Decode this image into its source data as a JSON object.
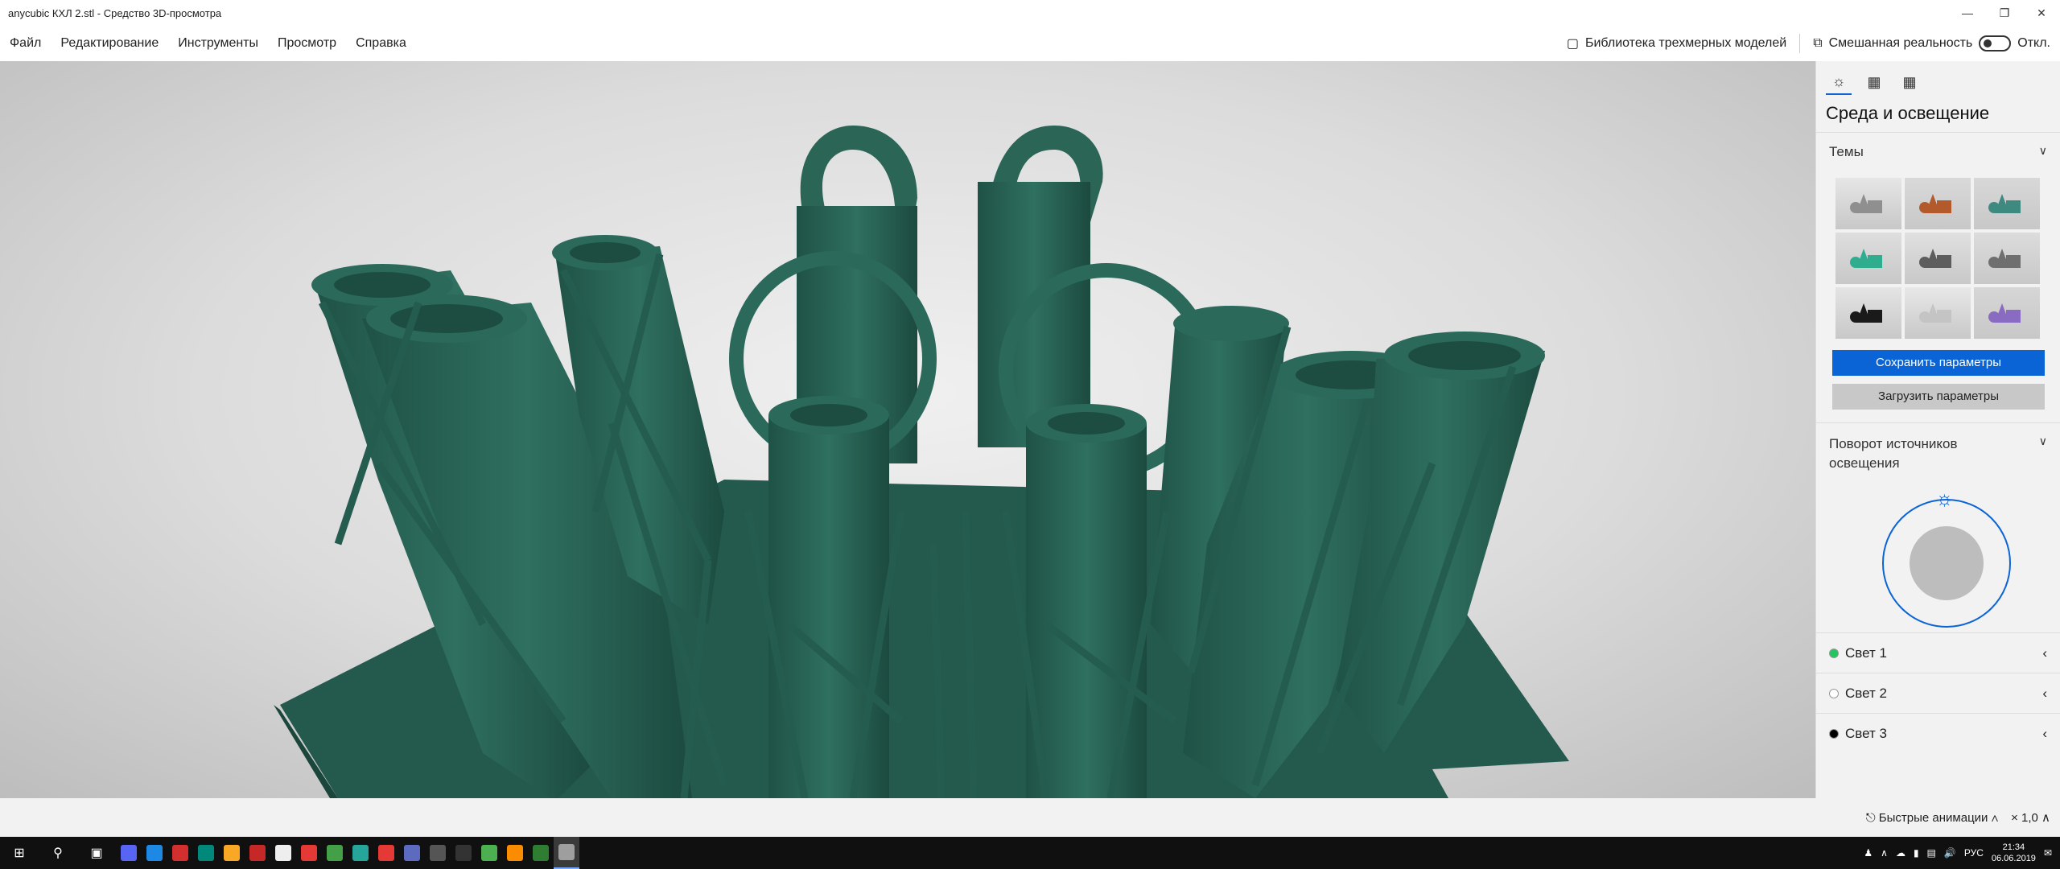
{
  "window": {
    "title": "anycubic КХЛ 2.stl - Средство 3D-просмотра"
  },
  "menu": {
    "items": [
      "Файл",
      "Редактирование",
      "Инструменты",
      "Просмотр",
      "Справка"
    ],
    "library_label": "Библиотека трехмерных моделей",
    "mixed_reality_label": "Смешанная реальность",
    "toggle_state": "Откл."
  },
  "panel": {
    "title": "Среда и освещение",
    "themes_header": "Темы",
    "themes": [
      {
        "bg": "#e6e6e6",
        "obj": "#8f8f8f"
      },
      {
        "bg": "#d9d9d9",
        "obj": "#b35a2d"
      },
      {
        "bg": "#d8d8d8",
        "obj": "#3f8a80"
      },
      {
        "bg": "#dedede",
        "obj": "#2eae8f"
      },
      {
        "bg": "#e0e0e0",
        "obj": "#5d5d5d"
      },
      {
        "bg": "#dcdcdc",
        "obj": "#6f6f6f"
      },
      {
        "bg": "#e4e4e4",
        "obj": "#1a1a1a"
      },
      {
        "bg": "#e8e8e8",
        "obj": "#c4c4c4"
      },
      {
        "bg": "#d6d6d6",
        "obj": "#8a6bc2"
      }
    ],
    "save_label": "Сохранить параметры",
    "load_label": "Загрузить параметры",
    "rotation_header": "Поворот источников освещения",
    "lights": [
      {
        "label": "Свет 1",
        "color": "#22c55e"
      },
      {
        "label": "Свет 2",
        "color": "#ffffff"
      },
      {
        "label": "Свет 3",
        "color": "#000000"
      }
    ]
  },
  "status": {
    "animations_label": "Быстрые анимации",
    "zoom_label": "× 1,0"
  },
  "taskbar": {
    "apps": [
      {
        "name": "discord",
        "color": "#5865f2"
      },
      {
        "name": "edge",
        "color": "#1e88e5"
      },
      {
        "name": "record",
        "color": "#d32f2f"
      },
      {
        "name": "photos",
        "color": "#00897b"
      },
      {
        "name": "folder",
        "color": "#f9a825"
      },
      {
        "name": "game",
        "color": "#c62828"
      },
      {
        "name": "mail",
        "color": "#eeeeee"
      },
      {
        "name": "opera",
        "color": "#e53935"
      },
      {
        "name": "chrome",
        "color": "#43a047"
      },
      {
        "name": "m-app",
        "color": "#26a69a"
      },
      {
        "name": "yandex",
        "color": "#e53935"
      },
      {
        "name": "settings",
        "color": "#5c6bc0"
      },
      {
        "name": "terminal",
        "color": "#555555"
      },
      {
        "name": "slicer",
        "color": "#333333"
      },
      {
        "name": "utorrent",
        "color": "#4caf50"
      },
      {
        "name": "maps",
        "color": "#fb8c00"
      },
      {
        "name": "excel",
        "color": "#2e7d32"
      },
      {
        "name": "3d-viewer",
        "color": "#9e9e9e"
      }
    ],
    "lang": "РУС",
    "time": "21:34",
    "date": "06.06.2019"
  }
}
